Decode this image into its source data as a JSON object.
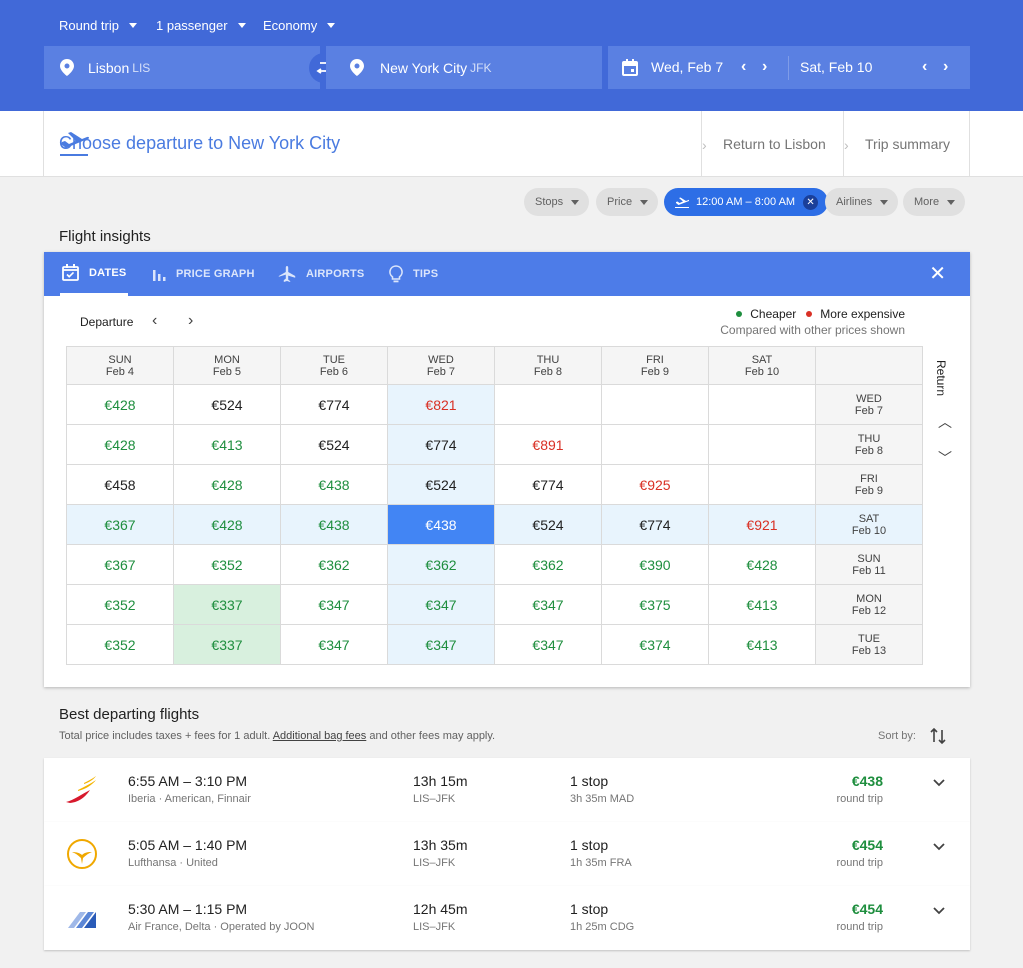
{
  "header": {
    "trip_type": "Round trip",
    "passengers": "1 passenger",
    "cabin": "Economy",
    "origin": {
      "city": "Lisbon",
      "code": "LIS"
    },
    "destination": {
      "city": "New York City",
      "code": "JFK"
    },
    "depart_date": "Wed, Feb 7",
    "return_date": "Sat, Feb 10"
  },
  "subheader": {
    "title": "Choose departure to New York City",
    "crumb_return": "Return to Lisbon",
    "crumb_summary": "Trip summary"
  },
  "filters": {
    "stops": "Stops",
    "price": "Price",
    "time": "12:00 AM – 8:00 AM",
    "airlines": "Airlines",
    "more": "More"
  },
  "insights": {
    "title": "Flight insights",
    "tabs": [
      "DATES",
      "PRICE GRAPH",
      "AIRPORTS",
      "TIPS"
    ],
    "departure_label": "Departure",
    "legend_cheaper": "Cheaper",
    "legend_expensive": "More expensive",
    "legend_note": "Compared with other prices shown",
    "return_label": "Return",
    "columns": [
      {
        "day": "SUN",
        "date": "Feb 4"
      },
      {
        "day": "MON",
        "date": "Feb 5"
      },
      {
        "day": "TUE",
        "date": "Feb 6"
      },
      {
        "day": "WED",
        "date": "Feb 7"
      },
      {
        "day": "THU",
        "date": "Feb 8"
      },
      {
        "day": "FRI",
        "date": "Feb 9"
      },
      {
        "day": "SAT",
        "date": "Feb 10"
      }
    ],
    "rows": [
      {
        "day": "WED",
        "date": "Feb 7",
        "cells": [
          [
            "€428",
            "cheap"
          ],
          [
            "€524",
            "norm"
          ],
          [
            "€774",
            "norm"
          ],
          [
            "€821",
            "exp"
          ],
          [
            "",
            ""
          ],
          [
            "",
            ""
          ],
          [
            "",
            ""
          ]
        ]
      },
      {
        "day": "THU",
        "date": "Feb 8",
        "cells": [
          [
            "€428",
            "cheap"
          ],
          [
            "€413",
            "cheap"
          ],
          [
            "€524",
            "norm"
          ],
          [
            "€774",
            "norm"
          ],
          [
            "€891",
            "exp"
          ],
          [
            "",
            ""
          ],
          [
            "",
            ""
          ]
        ]
      },
      {
        "day": "FRI",
        "date": "Feb 9",
        "cells": [
          [
            "€458",
            "norm"
          ],
          [
            "€428",
            "cheap"
          ],
          [
            "€438",
            "cheap"
          ],
          [
            "€524",
            "norm"
          ],
          [
            "€774",
            "norm"
          ],
          [
            "€925",
            "exp"
          ],
          [
            "",
            ""
          ]
        ]
      },
      {
        "day": "SAT",
        "date": "Feb 10",
        "cells": [
          [
            "€367",
            "cheap"
          ],
          [
            "€428",
            "cheap"
          ],
          [
            "€438",
            "cheap"
          ],
          [
            "€438",
            "norm"
          ],
          [
            "€524",
            "norm"
          ],
          [
            "€774",
            "norm"
          ],
          [
            "€921",
            "exp"
          ]
        ]
      },
      {
        "day": "SUN",
        "date": "Feb 11",
        "cells": [
          [
            "€367",
            "cheap"
          ],
          [
            "€352",
            "cheap"
          ],
          [
            "€362",
            "cheap"
          ],
          [
            "€362",
            "cheap"
          ],
          [
            "€362",
            "cheap"
          ],
          [
            "€390",
            "cheap"
          ],
          [
            "€428",
            "cheap"
          ]
        ]
      },
      {
        "day": "MON",
        "date": "Feb 12",
        "cells": [
          [
            "€352",
            "cheap"
          ],
          [
            "€337",
            "cheap"
          ],
          [
            "€347",
            "cheap"
          ],
          [
            "€347",
            "cheap"
          ],
          [
            "€347",
            "cheap"
          ],
          [
            "€375",
            "cheap"
          ],
          [
            "€413",
            "cheap"
          ]
        ]
      },
      {
        "day": "TUE",
        "date": "Feb 13",
        "cells": [
          [
            "€352",
            "cheap"
          ],
          [
            "€337",
            "cheap"
          ],
          [
            "€347",
            "cheap"
          ],
          [
            "€347",
            "cheap"
          ],
          [
            "€347",
            "cheap"
          ],
          [
            "€374",
            "cheap"
          ],
          [
            "€413",
            "cheap"
          ]
        ]
      }
    ]
  },
  "results": {
    "title": "Best departing flights",
    "note_prefix": "Total price includes taxes + fees for 1 adult.",
    "note_link": "Additional bag fees",
    "note_suffix": "and other fees may apply.",
    "sort_label": "Sort by:",
    "flights": [
      {
        "times": "6:55 AM – 3:10 PM",
        "airline": "Iberia · American, Finnair",
        "duration": "13h 15m",
        "route": "LIS–JFK",
        "stops": "1 stop",
        "layover": "3h 35m MAD",
        "price": "€438",
        "price_type": "round trip"
      },
      {
        "times": "5:05 AM – 1:40 PM",
        "airline": "Lufthansa · United",
        "duration": "13h 35m",
        "route": "LIS–JFK",
        "stops": "1 stop",
        "layover": "1h 35m FRA",
        "price": "€454",
        "price_type": "round trip"
      },
      {
        "times": "5:30 AM – 1:15 PM",
        "airline": "Air France, Delta · Operated by JOON",
        "duration": "12h 45m",
        "route": "LIS–JFK",
        "stops": "1 stop",
        "layover": "1h 25m CDG",
        "price": "€454",
        "price_type": "round trip"
      }
    ]
  },
  "colors": {
    "header_blue": "#4169d8",
    "cheap": "#1e8e3e",
    "expensive": "#d93025",
    "selected": "#4285f4"
  }
}
